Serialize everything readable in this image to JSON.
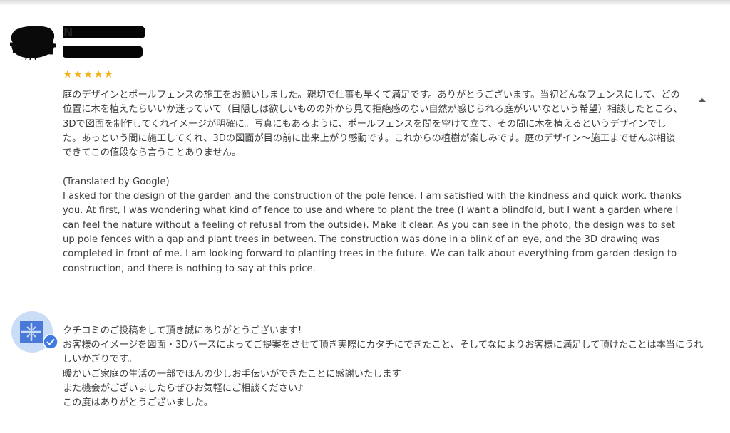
{
  "review": {
    "reviewer_initial": "N",
    "rating_stars": "★★★★★",
    "rating_value": 5,
    "original_text": "庭のデザインとポールフェンスの施工をお願いしました。親切で仕事も早くて満足です。ありがとうございます。当初どんなフェンスにして、どの位置に木を植えたらいいか迷っていて（目隠しは欲しいものの外から見て拒絶感のない自然が感じられる庭がいいなという希望）相談したところ、3Dで図面を制作してくれイメージが明確に。写真にもあるように、ポールフェンスを間を空けて立て、その間に木を植えるというデザインでした。あっという間に施工してくれ、3Dの図面が目の前に出来上がり感動です。これからの植樹が楽しみです。庭のデザイン〜施工までぜんぶ相談できてこの値段なら言うことありません。",
    "translated_label": "(Translated by Google)",
    "translated_text": "I asked for the design of the garden and the construction of the pole fence. I am satisfied with the kindness and quick work. thanks you. At first, I was wondering what kind of fence to use and where to plant the tree (I want a blindfold, but I want a garden where I can feel the nature without a feeling of refusal from the outside). Make it clear. As you can see in the photo, the design was to set up pole fences with a gap and plant trees in between. The construction was done in a blink of an eye, and the 3D drawing was completed in front of me. I am looking forward to planting trees in the future. We can talk about everything from garden design to construction, and there is nothing to say at this price."
  },
  "owner_response": {
    "lines": [
      "クチコミのご投稿をして頂き誠にありがとうございます！",
      "お客様のイメージを図面・3Dパースによってご提案をさせて頂き実際にカタチにできたこと、そしてなによりお客様に満足して頂けたことは本当にうれしいかぎりです。",
      "暖かいご家庭の生活の一部でほんの少しお手伝いができたことに感謝いたします。",
      "また機会がございましたらぜひお気軽にご相談ください♪",
      "この度はありがとうございました。"
    ]
  },
  "icons": {
    "collapse": "chevron-up-icon",
    "verified": "verified-check-icon",
    "owner_logo": "owner-logo-icon"
  },
  "colors": {
    "star": "#f1b21c",
    "verified_badge": "#3f7ae0",
    "owner_avatar_bg": "#c9ddf7",
    "owner_logo": "#4a78d8"
  }
}
